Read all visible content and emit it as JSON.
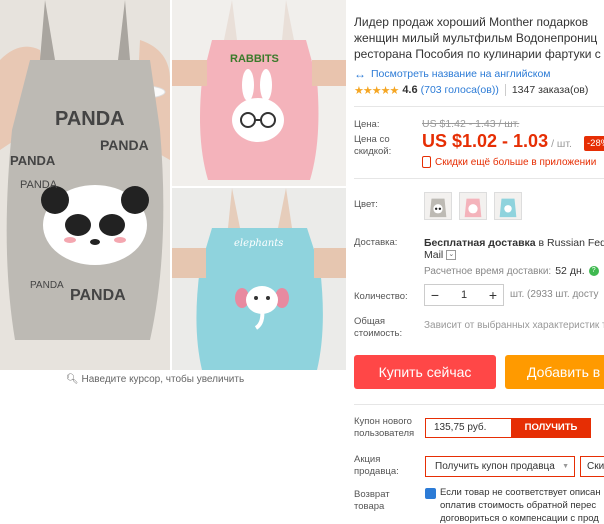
{
  "gallery": {
    "zoom_hint": "Наведите курсор, чтобы увеличить",
    "main_image_text": {
      "line1": "PANDA",
      "line2": "PANDA",
      "line3": "PANDA",
      "line4": "PANDA",
      "line5": "PANDA",
      "line6": "PANDA"
    },
    "pink_image_text": "RABBITS",
    "blue_image_text": "elephants"
  },
  "product": {
    "title_lines": [
      "Лидер продаж хороший Monther подарков",
      "женщин милый мультфильм Водонепрониц",
      "ресторана Пособия по кулинарии фартуки с"
    ],
    "translate_link": "Посмотреть название на английском",
    "rating": {
      "stars": "★★★★★",
      "value": "4.6",
      "votes": "(703 голоса(ов))",
      "orders": "1347 заказа(ов)"
    }
  },
  "price": {
    "label_price": "Цена:",
    "old": "US $1.42 - 1.43 / шт.",
    "label_discount_price": "Цена со скидкой:",
    "new": "US $1.02 - 1.03",
    "per": "/ шт.",
    "discount_badge": "-28%",
    "app_promo": "Скидки ещё больше в приложении"
  },
  "options": {
    "color_label": "Цвет:",
    "swatches": [
      "panda-swatch",
      "rabbit-swatch",
      "elephant-swatch"
    ]
  },
  "shipping": {
    "label": "Доставка:",
    "free": "Бесплатная доставка",
    "to": "в",
    "carrier": "Russian Feder",
    "mail": "Mail",
    "time_label": "Расчетное время доставки:",
    "time_value": "52 дн."
  },
  "quantity": {
    "label": "Количество:",
    "minus": "−",
    "value": "1",
    "plus": "+",
    "available": "шт. (2933 шт. досту"
  },
  "total": {
    "label": "Общая стоимость:",
    "note": "Зависит от выбранных характеристик т"
  },
  "actions": {
    "buy_now": "Купить сейчас",
    "add_to_cart": "Добавить в"
  },
  "coupons": {
    "new_user_label": "Купон нового пользователя",
    "new_user_amount": "135,75 руб.",
    "get": "ПОЛУЧИТЬ",
    "seller_label": "Акция продавца:",
    "seller_coupon": "Получить купон продавца",
    "seller_coupon2": "Ски"
  },
  "returns": {
    "label": "Возврат товара",
    "lines": [
      "Если товар не соответствует описан",
      "оплатив стоимость обратной перес",
      "договориться о компенсации с прод"
    ]
  },
  "colors": {
    "accent_red": "#e62e04",
    "buy_red": "#ff4747",
    "cart_orange": "#ff9a00",
    "link_blue": "#2c7bd6",
    "star": "#f5a623"
  }
}
